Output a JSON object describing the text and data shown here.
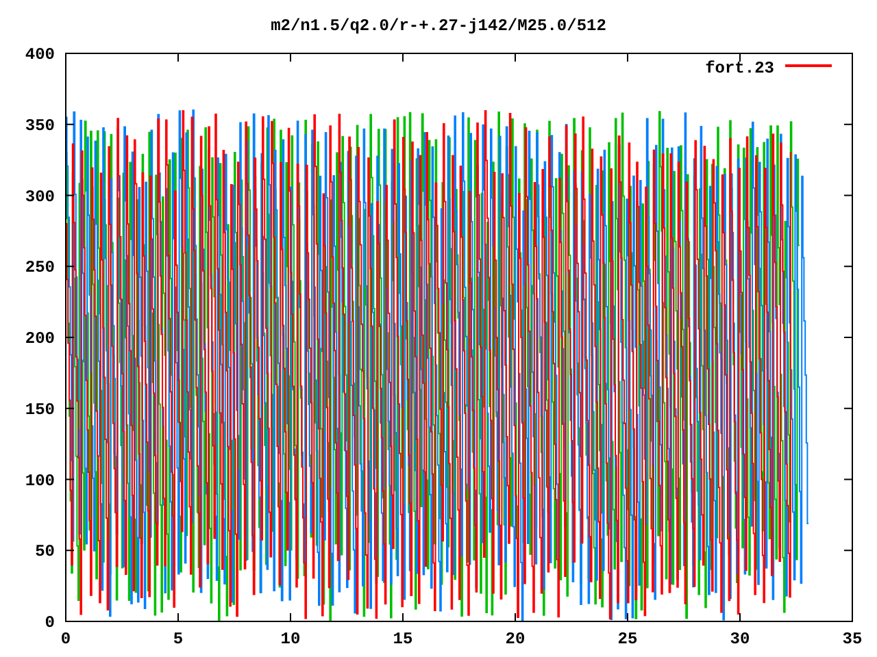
{
  "chart": {
    "title": "m2/n1.5/q2.0/r-+.27-j142/M25.0/512",
    "yticks": [
      "400",
      "350",
      "300",
      "250",
      "200",
      "150",
      "100",
      "50",
      "0"
    ],
    "xticks": [
      "0",
      "5",
      "10",
      "15",
      "20",
      "25",
      "30",
      "35"
    ],
    "legend": {
      "label": "fort.23",
      "color": "#ff0000"
    }
  }
}
